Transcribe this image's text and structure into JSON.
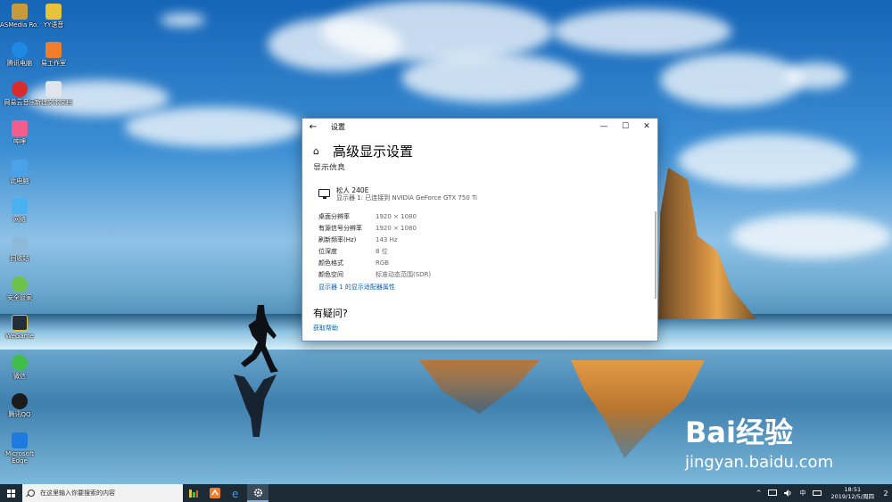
{
  "desktop": {
    "icons": [
      {
        "label": "ASMedia Ro...",
        "color": "#c89a3a"
      },
      {
        "label": "YY语音",
        "color": "#e8c23a"
      },
      {
        "label": "腾讯电脑",
        "color": "#1e88e5"
      },
      {
        "label": "易工作室",
        "color": "#f07d2a"
      },
      {
        "label": "网易云音乐",
        "color": "#d82c2c"
      },
      {
        "label": "新建文本文档",
        "color": "#dfe5ea"
      },
      {
        "label": "哔哩",
        "color": "#f25d8e"
      },
      {
        "label": "此电脑",
        "color": "#4aa3e8"
      },
      {
        "label": "网络",
        "color": "#4ab0f0"
      },
      {
        "label": "回收站",
        "color": "#8fb9d8"
      },
      {
        "label": "安全管家",
        "color": "#6cc24a"
      },
      {
        "label": "WeGame",
        "color": "#222f3a"
      },
      {
        "label": "微信",
        "color": "#3fbf4a"
      },
      {
        "label": "腾讯QQ",
        "color": "#1b1b1b"
      },
      {
        "label": "Microsoft Edge",
        "color": "#1f7ae0"
      }
    ]
  },
  "window": {
    "title": "设置",
    "back_icon": "←",
    "minimize_icon": "—",
    "maximize_icon": "☐",
    "close_icon": "✕",
    "home_icon": "⌂",
    "page_title": "高级显示设置",
    "section_title": "显示信息",
    "monitor": {
      "name": "松人 240E",
      "description": "显示器 1: 已连接到 NVIDIA GeForce GTX 750 Ti"
    },
    "properties": [
      {
        "label": "桌面分辨率",
        "value": "1920 × 1080"
      },
      {
        "label": "有源信号分辨率",
        "value": "1920 × 1080"
      },
      {
        "label": "刷新频率(Hz)",
        "value": "143 Hz"
      },
      {
        "label": "位深度",
        "value": "8 位"
      },
      {
        "label": "颜色格式",
        "value": "RGB"
      },
      {
        "label": "颜色空间",
        "value": "标准动态范围(SDR)"
      }
    ],
    "adapter_link": "显示器 1 的显示适配器属性",
    "help_title": "有疑问?",
    "help_link": "获取帮助"
  },
  "taskbar": {
    "search_placeholder": "在这里输入你要搜索的内容",
    "tray_chevron": "^",
    "ime": "中",
    "time": "18:51",
    "date": "2019/12/5/周四",
    "notification_count": "2"
  },
  "watermark": {
    "brand": "Bai经验",
    "url": "jingyan.baidu.com"
  }
}
